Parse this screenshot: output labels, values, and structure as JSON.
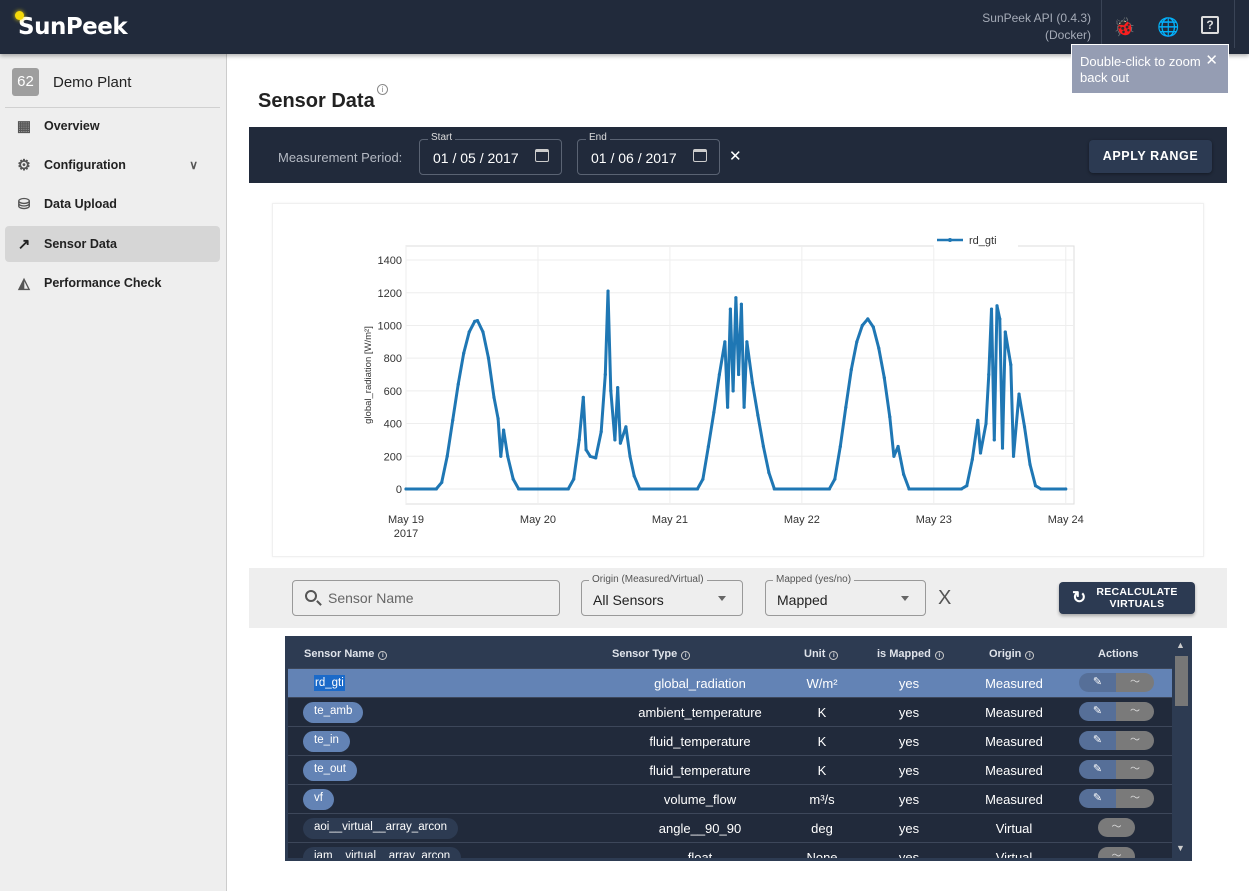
{
  "app": {
    "logo": "SunPeek",
    "api_version": "SunPeek API (0.4.3)",
    "api_env": "(Docker)",
    "icons": [
      "bug-icon",
      "globe-icon",
      "help-icon"
    ],
    "bug_color": "#e53935"
  },
  "tooltip": {
    "text": "Double-click to zoom back out",
    "close": "✕"
  },
  "sidebar": {
    "plant_id": "62",
    "plant_name": "Demo Plant",
    "items": [
      {
        "label": "Overview",
        "icon": "grid-icon"
      },
      {
        "label": "Configuration",
        "icon": "gear-icon",
        "expandable": true
      },
      {
        "label": "Data Upload",
        "icon": "database-upload-icon"
      },
      {
        "label": "Sensor Data",
        "icon": "trend-icon",
        "active": true
      },
      {
        "label": "Performance Check",
        "icon": "area-chart-icon"
      }
    ]
  },
  "page": {
    "title": "Sensor Data"
  },
  "period": {
    "label": "Measurement Period:",
    "start_label": "Start",
    "start": "01 / 05 / 2017",
    "end_label": "End",
    "end": "01 / 06 / 2017",
    "clear": "✕",
    "apply": "APPLY RANGE"
  },
  "chart_data": {
    "type": "line",
    "title": "",
    "xlabel": "",
    "ylabel": "global_radiation [W/m²]",
    "legend": {
      "entries": [
        "rd_gti"
      ],
      "placement": "top-right"
    },
    "color": "#1f77b4",
    "grid": true,
    "ylim": [
      -92,
      1486
    ],
    "yticks": [
      0,
      200,
      400,
      600,
      800,
      1000,
      1200,
      1400
    ],
    "xlim": [
      "2017-05-19 00:00",
      "2017-05-24 01:30"
    ],
    "xticks": [
      {
        "at": "2017-05-19 00:00",
        "label": "May 19",
        "sub": "2017"
      },
      {
        "at": "2017-05-20 00:00",
        "label": "May 20"
      },
      {
        "at": "2017-05-21 00:00",
        "label": "May 21"
      },
      {
        "at": "2017-05-22 00:00",
        "label": "May 22"
      },
      {
        "at": "2017-05-23 00:00",
        "label": "May 23"
      },
      {
        "at": "2017-05-24 00:00",
        "label": "May 24"
      }
    ],
    "series": [
      {
        "name": "rd_gti",
        "points": [
          [
            "2017-05-19 00:00",
            0
          ],
          [
            "2017-05-19 05:30",
            0
          ],
          [
            "2017-05-19 06:30",
            40
          ],
          [
            "2017-05-19 07:30",
            200
          ],
          [
            "2017-05-19 08:30",
            420
          ],
          [
            "2017-05-19 09:30",
            640
          ],
          [
            "2017-05-19 10:30",
            830
          ],
          [
            "2017-05-19 11:30",
            960
          ],
          [
            "2017-05-19 12:30",
            1025
          ],
          [
            "2017-05-19 13:00",
            1030
          ],
          [
            "2017-05-19 14:00",
            960
          ],
          [
            "2017-05-19 15:00",
            800
          ],
          [
            "2017-05-19 16:00",
            560
          ],
          [
            "2017-05-19 16:45",
            430
          ],
          [
            "2017-05-19 17:15",
            200
          ],
          [
            "2017-05-19 17:45",
            360
          ],
          [
            "2017-05-19 18:30",
            200
          ],
          [
            "2017-05-19 19:30",
            60
          ],
          [
            "2017-05-19 20:30",
            0
          ],
          [
            "2017-05-20 05:30",
            0
          ],
          [
            "2017-05-20 06:30",
            60
          ],
          [
            "2017-05-20 07:30",
            300
          ],
          [
            "2017-05-20 08:15",
            560
          ],
          [
            "2017-05-20 08:45",
            240
          ],
          [
            "2017-05-20 09:30",
            200
          ],
          [
            "2017-05-20 10:30",
            190
          ],
          [
            "2017-05-20 11:30",
            350
          ],
          [
            "2017-05-20 12:15",
            700
          ],
          [
            "2017-05-20 12:45",
            1210
          ],
          [
            "2017-05-20 13:15",
            600
          ],
          [
            "2017-05-20 14:00",
            300
          ],
          [
            "2017-05-20 14:30",
            620
          ],
          [
            "2017-05-20 15:00",
            280
          ],
          [
            "2017-05-20 16:00",
            380
          ],
          [
            "2017-05-20 16:45",
            200
          ],
          [
            "2017-05-20 17:30",
            80
          ],
          [
            "2017-05-20 18:30",
            0
          ],
          [
            "2017-05-21 05:00",
            0
          ],
          [
            "2017-05-21 06:00",
            60
          ],
          [
            "2017-05-21 07:00",
            260
          ],
          [
            "2017-05-21 08:00",
            470
          ],
          [
            "2017-05-21 09:00",
            700
          ],
          [
            "2017-05-21 10:00",
            900
          ],
          [
            "2017-05-21 10:30",
            500
          ],
          [
            "2017-05-21 11:00",
            1100
          ],
          [
            "2017-05-21 11:30",
            600
          ],
          [
            "2017-05-21 12:00",
            1170
          ],
          [
            "2017-05-21 12:30",
            700
          ],
          [
            "2017-05-21 13:00",
            1130
          ],
          [
            "2017-05-21 13:30",
            500
          ],
          [
            "2017-05-21 14:00",
            900
          ],
          [
            "2017-05-21 15:00",
            650
          ],
          [
            "2017-05-21 16:00",
            450
          ],
          [
            "2017-05-21 17:00",
            260
          ],
          [
            "2017-05-21 18:00",
            100
          ],
          [
            "2017-05-21 19:00",
            0
          ],
          [
            "2017-05-22 05:00",
            0
          ],
          [
            "2017-05-22 06:00",
            60
          ],
          [
            "2017-05-22 07:00",
            260
          ],
          [
            "2017-05-22 08:00",
            500
          ],
          [
            "2017-05-22 09:00",
            730
          ],
          [
            "2017-05-22 10:00",
            900
          ],
          [
            "2017-05-22 11:00",
            1000
          ],
          [
            "2017-05-22 12:00",
            1040
          ],
          [
            "2017-05-22 13:00",
            990
          ],
          [
            "2017-05-22 14:00",
            860
          ],
          [
            "2017-05-22 15:00",
            680
          ],
          [
            "2017-05-22 16:00",
            440
          ],
          [
            "2017-05-22 16:45",
            200
          ],
          [
            "2017-05-22 17:30",
            260
          ],
          [
            "2017-05-22 18:30",
            90
          ],
          [
            "2017-05-22 19:30",
            0
          ],
          [
            "2017-05-23 05:00",
            0
          ],
          [
            "2017-05-23 06:00",
            20
          ],
          [
            "2017-05-23 07:00",
            180
          ],
          [
            "2017-05-23 08:00",
            420
          ],
          [
            "2017-05-23 08:30",
            220
          ],
          [
            "2017-05-23 09:30",
            400
          ],
          [
            "2017-05-23 10:00",
            700
          ],
          [
            "2017-05-23 10:30",
            1100
          ],
          [
            "2017-05-23 11:00",
            300
          ],
          [
            "2017-05-23 11:30",
            1120
          ],
          [
            "2017-05-23 12:00",
            1040
          ],
          [
            "2017-05-23 12:30",
            250
          ],
          [
            "2017-05-23 13:00",
            960
          ],
          [
            "2017-05-23 14:00",
            760
          ],
          [
            "2017-05-23 14:30",
            200
          ],
          [
            "2017-05-23 15:30",
            580
          ],
          [
            "2017-05-23 16:30",
            380
          ],
          [
            "2017-05-23 17:30",
            150
          ],
          [
            "2017-05-23 18:30",
            20
          ],
          [
            "2017-05-23 19:30",
            0
          ],
          [
            "2017-05-24 00:00",
            0
          ]
        ]
      }
    ]
  },
  "filters": {
    "search_placeholder": "Sensor Name",
    "origin_label": "Origin (Measured/Virtual)",
    "origin_value": "All Sensors",
    "mapped_label": "Mapped (yes/no)",
    "mapped_value": "Mapped",
    "clear": "X",
    "recalc": "RECALCULATE VIRTUALS"
  },
  "table": {
    "headers": [
      "Sensor Name",
      "Sensor Type",
      "Unit",
      "is Mapped",
      "Origin",
      "Actions"
    ],
    "rows": [
      {
        "name": "rd_gti",
        "type": "global_radiation",
        "unit": "W/m²",
        "mapped": "yes",
        "origin": "Measured",
        "selected": true
      },
      {
        "name": "te_amb",
        "type": "ambient_temperature",
        "unit": "K",
        "mapped": "yes",
        "origin": "Measured"
      },
      {
        "name": "te_in",
        "type": "fluid_temperature",
        "unit": "K",
        "mapped": "yes",
        "origin": "Measured"
      },
      {
        "name": "te_out",
        "type": "fluid_temperature",
        "unit": "K",
        "mapped": "yes",
        "origin": "Measured"
      },
      {
        "name": "vf",
        "type": "volume_flow",
        "unit": "m³/s",
        "mapped": "yes",
        "origin": "Measured"
      },
      {
        "name": "aoi__virtual__array_arcon",
        "type": "angle__90_90",
        "unit": "deg",
        "mapped": "yes",
        "origin": "Virtual"
      },
      {
        "name": "iam__virtual__array_arcon",
        "type": "float",
        "unit": "None",
        "mapped": "yes",
        "origin": "Virtual"
      }
    ]
  }
}
